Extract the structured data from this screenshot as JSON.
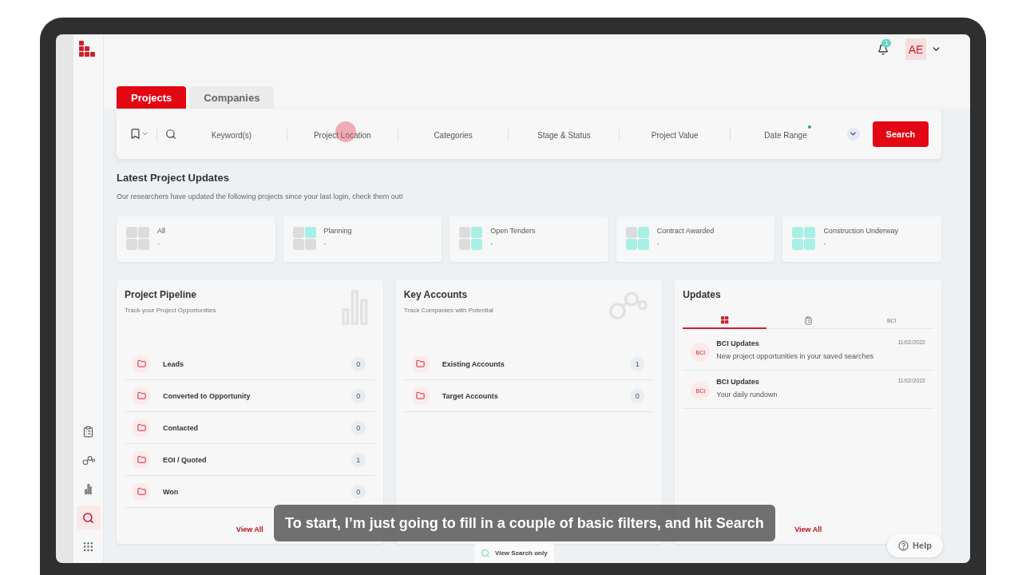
{
  "header": {
    "notifications": "1",
    "avatar": "AE"
  },
  "sidebar": {
    "items": [
      {
        "kind": "clipboard",
        "selected": false
      },
      {
        "kind": "network",
        "selected": false
      },
      {
        "kind": "chart",
        "selected": false
      },
      {
        "kind": "search",
        "selected": true
      },
      {
        "kind": "apps",
        "selected": false
      }
    ]
  },
  "tabs": [
    {
      "label": "Projects",
      "selected": true
    },
    {
      "label": "Companies",
      "selected": false
    }
  ],
  "filters": {
    "fields": [
      {
        "label": "Keyword(s)",
        "clicked": false,
        "marked": false
      },
      {
        "label": "Project Location",
        "clicked": true,
        "marked": false
      },
      {
        "label": "Categories",
        "clicked": false,
        "marked": false
      },
      {
        "label": "Stage & Status",
        "clicked": false,
        "marked": false
      },
      {
        "label": "Project Value",
        "clicked": false,
        "marked": false
      },
      {
        "label": "Date Range",
        "clicked": false,
        "marked": true
      }
    ],
    "search_button": "Search"
  },
  "latest": {
    "title": "Latest Project Updates",
    "subtitle": "Our researchers have updated the following projects since your last login, check them out!",
    "statuses": [
      {
        "label": "All",
        "value": "-",
        "cells": [
          {
            "filled": false
          },
          {
            "filled": false
          },
          {
            "filled": false
          },
          {
            "filled": false
          }
        ]
      },
      {
        "label": "Planning",
        "value": "-",
        "cells": [
          {
            "filled": false
          },
          {
            "filled": true
          },
          {
            "filled": false
          },
          {
            "filled": false
          }
        ]
      },
      {
        "label": "Open Tenders",
        "value": "-",
        "cells": [
          {
            "filled": false
          },
          {
            "filled": true
          },
          {
            "filled": false
          },
          {
            "filled": true
          }
        ]
      },
      {
        "label": "Contract Awarded",
        "value": "-",
        "cells": [
          {
            "filled": false
          },
          {
            "filled": true
          },
          {
            "filled": true
          },
          {
            "filled": true
          }
        ]
      },
      {
        "label": "Construction Underway",
        "value": "-",
        "cells": [
          {
            "filled": true
          },
          {
            "filled": true
          },
          {
            "filled": true
          },
          {
            "filled": true
          }
        ]
      }
    ]
  },
  "panels": [
    {
      "title": "Project Pipeline",
      "subtitle": "Track your Project Opportunities",
      "kind": "chart",
      "rows": [
        {
          "label": "Leads",
          "count": "0"
        },
        {
          "label": "Converted to Opportunity",
          "count": "0"
        },
        {
          "label": "Contacted",
          "count": "0"
        },
        {
          "label": "EOI / Quoted",
          "count": "1"
        },
        {
          "label": "Won",
          "count": "0"
        }
      ],
      "view_all": "View All"
    },
    {
      "title": "Key Accounts",
      "subtitle": "Track Companies with Potential",
      "kind": "network",
      "rows": [
        {
          "label": "Existing Accounts",
          "count": "1"
        },
        {
          "label": "Target Accounts",
          "count": "0"
        }
      ]
    }
  ],
  "updates": {
    "title": "Updates",
    "tabs": [
      {
        "kind": "grid",
        "selected": true
      },
      {
        "kind": "clipboard",
        "selected": false
      },
      {
        "kind": "text",
        "label": "BCI",
        "selected": false
      }
    ],
    "items": [
      {
        "badge": "BCI",
        "title": "BCI Updates",
        "text": "New project opportunities in your saved searches",
        "date": "11/02/2022"
      },
      {
        "badge": "BCI",
        "title": "BCI Updates",
        "text": "Your daily rundown",
        "date": "11/02/2022"
      }
    ],
    "view_all": "View All"
  },
  "view_search": "View Search only",
  "help": "Help",
  "caption": "To start, I’m just going to fill in a couple of basic filters, and hit Search"
}
